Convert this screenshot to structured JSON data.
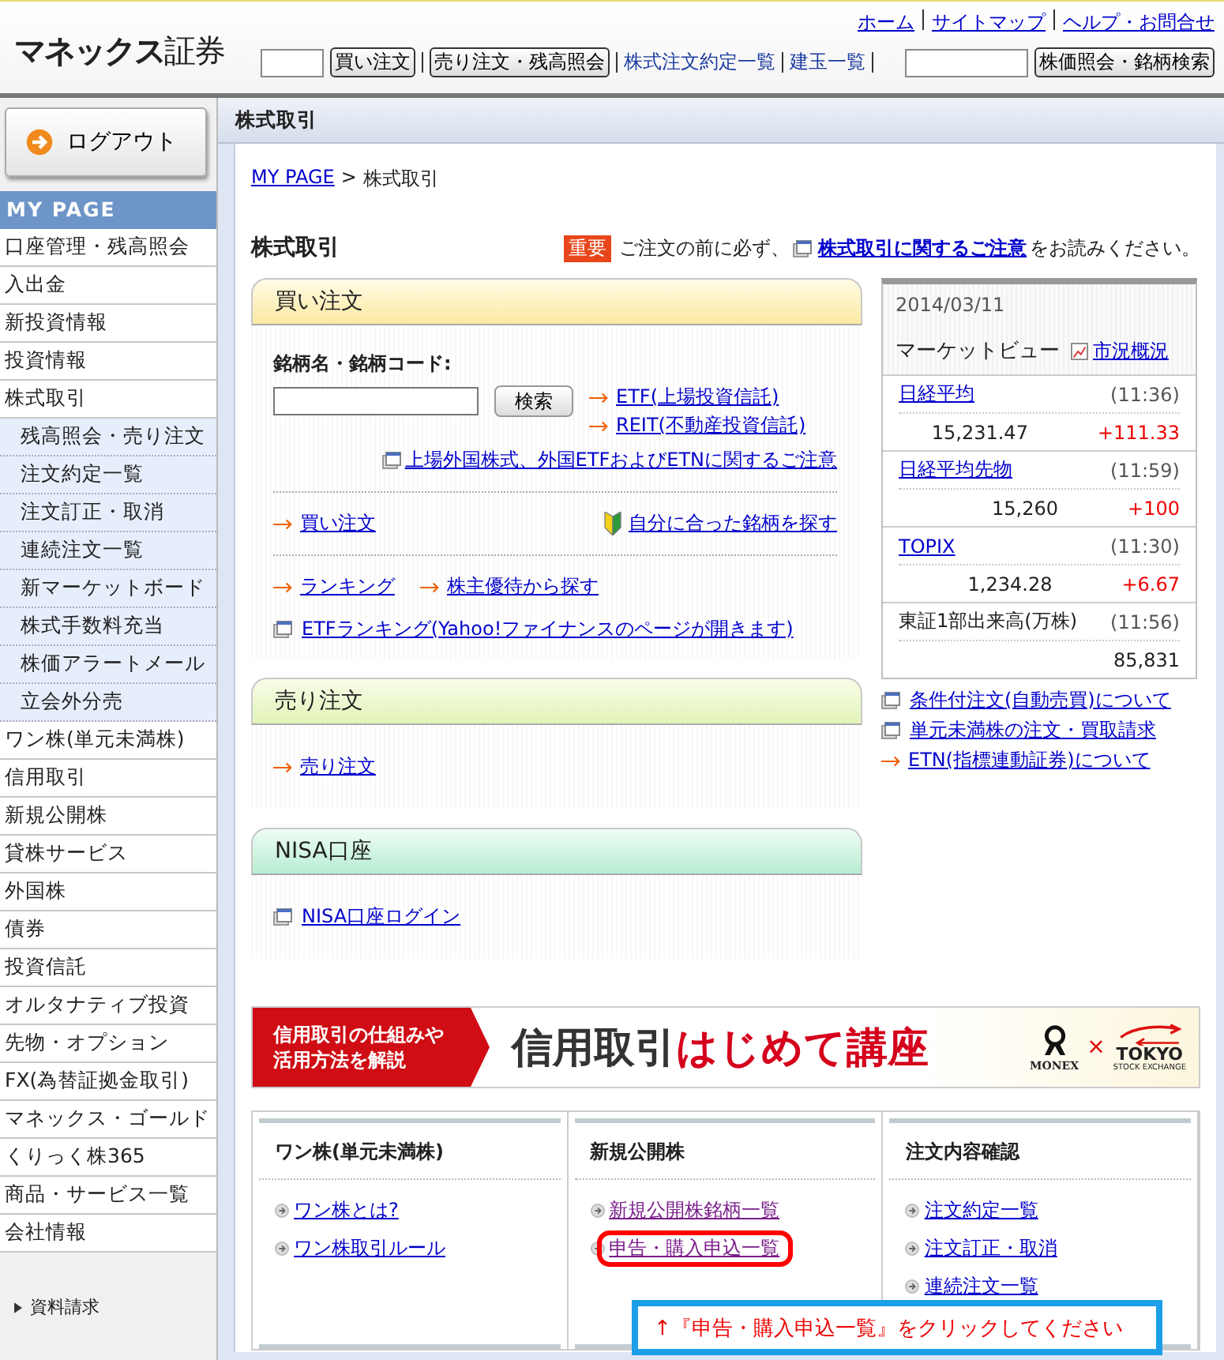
{
  "header": {
    "logo_main": "マネックス",
    "logo_suffix": "証券",
    "top_links": [
      "ホーム",
      "サイトマップ",
      "ヘルプ・お問合せ"
    ],
    "buy_button": "買い注文",
    "sell_button": "売り注文・残高照会",
    "links": [
      "株式注文約定一覧",
      "建玉一覧"
    ],
    "search_button": "株価照会・銘柄検索"
  },
  "sidebar": {
    "logout": "ログアウト",
    "section": "MY PAGE",
    "items": [
      {
        "label": "口座管理・残高照会"
      },
      {
        "label": "入出金"
      },
      {
        "label": "新投資情報"
      },
      {
        "label": "投資情報"
      },
      {
        "label": "株式取引",
        "children": [
          {
            "label": "残高照会・売り注文"
          },
          {
            "label": "注文約定一覧"
          },
          {
            "label": "注文訂正・取消"
          },
          {
            "label": "連続注文一覧"
          },
          {
            "label": "新マーケットボード"
          },
          {
            "label": "株式手数料充当"
          },
          {
            "label": "株価アラートメール"
          },
          {
            "label": "立会外分売"
          }
        ]
      },
      {
        "label": "ワン株(単元未満株)"
      },
      {
        "label": "信用取引"
      },
      {
        "label": "新規公開株"
      },
      {
        "label": "貸株サービス"
      },
      {
        "label": "外国株"
      },
      {
        "label": "債券"
      },
      {
        "label": "投資信託"
      },
      {
        "label": "オルタナティブ投資"
      },
      {
        "label": "先物・オプション"
      },
      {
        "label": "FX(為替証拠金取引)"
      },
      {
        "label": "マネックス・ゴールド"
      },
      {
        "label": "くりっく株365"
      },
      {
        "label": "商品・サービス一覧"
      },
      {
        "label": "会社情報"
      }
    ],
    "footer_link": "資料請求"
  },
  "page": {
    "tab_title": "株式取引",
    "breadcrumb": [
      "MY PAGE",
      "株式取引"
    ],
    "breadcrumb_separator": ">",
    "heading": "株式取引",
    "notice": {
      "badge": "重要",
      "before": "ご注文の前に必ず、",
      "link": "株式取引に関するご注意",
      "after": "をお読みください。"
    }
  },
  "buy_panel": {
    "title": "買い注文",
    "field_label": "銘柄名・銘柄コード:",
    "search_button": "検索",
    "side_links": [
      "ETF(上場投資信託)",
      "REIT(不動産投資信託)"
    ],
    "notice_link": "上場外国株式、外国ETFおよびETNに関するご注意",
    "buy_link": "買い注文",
    "finder_link": "自分に合った銘柄を探す",
    "ranking_link": "ランキング",
    "perks_link": "株主優待から探す",
    "etf_ranking_link": "ETFランキング(Yahoo!ファイナンスのページが開きます)"
  },
  "sell_panel": {
    "title": "売り注文",
    "link": "売り注文"
  },
  "nisa_panel": {
    "title": "NISA口座",
    "link": "NISA口座ログイン"
  },
  "market_view": {
    "date": "2014/03/11",
    "title": "マーケットビュー",
    "link": "市況概況",
    "rows": [
      {
        "kind": "link",
        "name": "日経平均",
        "time": "(11:36)",
        "value": "15,231.47",
        "change": "+111.33"
      },
      {
        "kind": "link",
        "name": "日経平均先物",
        "time": "(11:59)",
        "value": "15,260",
        "change": "+100"
      },
      {
        "kind": "link",
        "name": "TOPIX",
        "time": "(11:30)",
        "value": "1,234.28",
        "change": "+6.67"
      },
      {
        "kind": "text",
        "name": "東証1部出来高(万株)",
        "time": "(11:56)",
        "value": "85,831"
      }
    ]
  },
  "side_links": [
    {
      "kind": "window",
      "label": "条件付注文(自動売買)について"
    },
    {
      "kind": "window",
      "label": "単元未満株の注文・買取請求"
    },
    {
      "kind": "arrow",
      "label": "ETN(指標連動証券)について"
    }
  ],
  "banner": {
    "lead": [
      "信用取引の仕組みや",
      "活用方法を解説"
    ],
    "title_main": "信用取引",
    "title_accent": "はじめて講座",
    "partner_a": "MONEX",
    "times": "×",
    "partner_b": "TOKYO",
    "partner_b_sub": "STOCK EXCHANGE"
  },
  "columns": [
    {
      "title": "ワン株(単元未満株)",
      "links": [
        {
          "label": "ワン株とは?",
          "visited": false,
          "highlighted": false
        },
        {
          "label": "ワン株取引ルール",
          "visited": false,
          "highlighted": false
        }
      ]
    },
    {
      "title": "新規公開株",
      "links": [
        {
          "label": "新規公開株銘柄一覧",
          "visited": true,
          "highlighted": false
        },
        {
          "label": "申告・購入申込一覧",
          "visited": true,
          "highlighted": true
        }
      ]
    },
    {
      "title": "注文内容確認",
      "links": [
        {
          "label": "注文約定一覧",
          "visited": false,
          "highlighted": false
        },
        {
          "label": "注文訂正・取消",
          "visited": false,
          "highlighted": false
        },
        {
          "label": "連続注文一覧",
          "visited": false,
          "highlighted": false
        }
      ]
    }
  ],
  "callout": "↑『申告・購入申込一覧』をクリックしてください"
}
